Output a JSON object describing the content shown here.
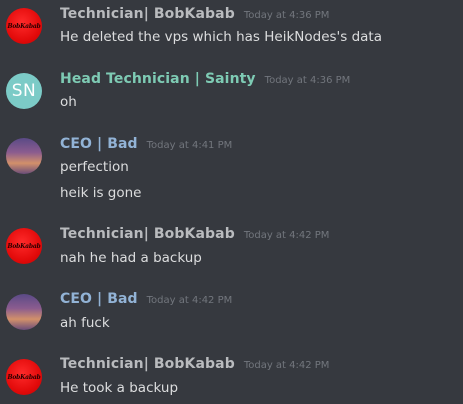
{
  "messages": [
    {
      "username": "Technician| BobKabab",
      "timestamp": "Today at 4:36 PM",
      "avatar_text": "BobKabab",
      "lines": [
        "He deleted the vps which has HeikNodes's data"
      ]
    },
    {
      "username": "Head Technician | Sainty",
      "timestamp": "Today at 4:36 PM",
      "avatar_text": "SN",
      "lines": [
        "oh"
      ]
    },
    {
      "username": "CEO | Bad",
      "timestamp": "Today at 4:41 PM",
      "avatar_text": "",
      "lines": [
        "perfection",
        "heik is gone"
      ]
    },
    {
      "username": "Technician| BobKabab",
      "timestamp": "Today at 4:42 PM",
      "avatar_text": "BobKabab",
      "lines": [
        "nah he had a backup"
      ]
    },
    {
      "username": "CEO | Bad",
      "timestamp": "Today at 4:42 PM",
      "avatar_text": "",
      "lines": [
        "ah fuck"
      ]
    },
    {
      "username": "Technician| BobKabab",
      "timestamp": "Today at 4:42 PM",
      "avatar_text": "BobKabab",
      "lines": [
        "He took a backup"
      ]
    }
  ],
  "colors": {
    "background": "#36393f",
    "message_text": "#dcddde",
    "timestamp": "#72767d",
    "technician_name": "#b9bbbe",
    "head_technician_name": "#7ecbb4",
    "ceo_name": "#92b3d6",
    "avatar_red": "#e30b0b",
    "avatar_teal": "#7ccbc7"
  }
}
